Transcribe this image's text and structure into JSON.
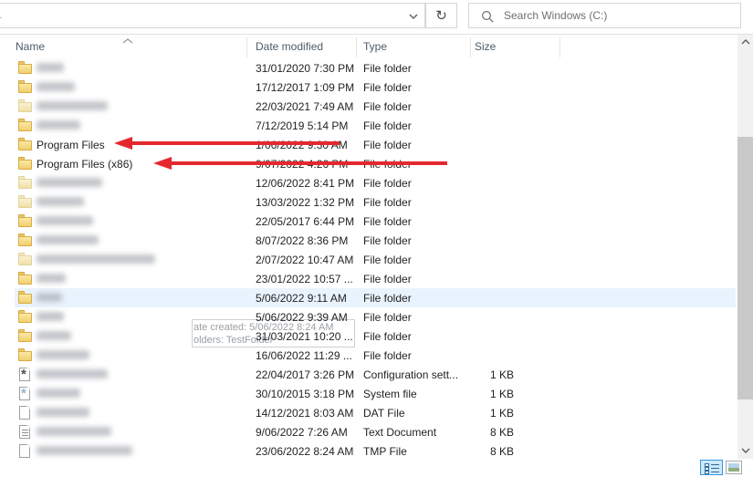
{
  "toolbar": {
    "refresh_glyph": "↻",
    "search": {
      "placeholder": "Search Windows (C:)"
    }
  },
  "columns": {
    "name": "Name",
    "date_modified": "Date modified",
    "type": "Type",
    "size": "Size"
  },
  "tooltip": {
    "line1": "ate created: 5/06/2022 8:24 AM",
    "line2": "olders: TestFolder"
  },
  "colors": {
    "arrow_red": "#e5282e",
    "row_highlight": "#e9f3fd",
    "folder_yellow": "#f2cf6e",
    "active_view_border": "#3a96dd"
  },
  "icons": {
    "search": "search-icon",
    "refresh": "refresh-icon",
    "address_chevron": "chevron-down-icon",
    "sort_ascending": "chevron-up-icon",
    "scroll_up": "chevron-up-icon",
    "scroll_down": "chevron-down-icon",
    "details_view": "details-view-icon",
    "thumbnails_view": "thumbnails-view-icon"
  },
  "rows": [
    {
      "name": "",
      "blurred": true,
      "blur_width": 30,
      "icon": "folder",
      "date": "31/01/2020 7:30 PM",
      "type": "File folder",
      "size": "",
      "highlighted": false
    },
    {
      "name": "",
      "blurred": true,
      "blur_width": 42,
      "icon": "folder",
      "date": "17/12/2017 1:09 PM",
      "type": "File folder",
      "size": "",
      "highlighted": false
    },
    {
      "name": "",
      "blurred": true,
      "blur_width": 78,
      "icon": "folder-pale",
      "date": "22/03/2021 7:49 AM",
      "type": "File folder",
      "size": "",
      "highlighted": false
    },
    {
      "name": "",
      "blurred": true,
      "blur_width": 48,
      "icon": "folder",
      "date": "7/12/2019 5:14 PM",
      "type": "File folder",
      "size": "",
      "highlighted": false
    },
    {
      "name": "Program Files",
      "blurred": false,
      "blur_width": 0,
      "icon": "folder",
      "date": "1/06/2022 9:30 AM",
      "type": "File folder",
      "size": "",
      "highlighted": false
    },
    {
      "name": "Program Files (x86)",
      "blurred": false,
      "blur_width": 0,
      "icon": "folder",
      "date": "9/07/2022 4:26 PM",
      "type": "File folder",
      "size": "",
      "highlighted": false
    },
    {
      "name": "",
      "blurred": true,
      "blur_width": 72,
      "icon": "folder-pale",
      "date": "12/06/2022 8:41 PM",
      "type": "File folder",
      "size": "",
      "highlighted": false
    },
    {
      "name": "",
      "blurred": true,
      "blur_width": 52,
      "icon": "folder-pale",
      "date": "13/03/2022 1:32 PM",
      "type": "File folder",
      "size": "",
      "highlighted": false
    },
    {
      "name": "",
      "blurred": true,
      "blur_width": 62,
      "icon": "folder",
      "date": "22/05/2017 6:44 PM",
      "type": "File folder",
      "size": "",
      "highlighted": false
    },
    {
      "name": "",
      "blurred": true,
      "blur_width": 68,
      "icon": "folder",
      "date": "8/07/2022 8:36 PM",
      "type": "File folder",
      "size": "",
      "highlighted": false
    },
    {
      "name": "",
      "blurred": true,
      "blur_width": 130,
      "icon": "folder-pale",
      "date": "2/07/2022 10:47 AM",
      "type": "File folder",
      "size": "",
      "highlighted": false
    },
    {
      "name": "",
      "blurred": true,
      "blur_width": 32,
      "icon": "folder",
      "date": "23/01/2022 10:57 ...",
      "type": "File folder",
      "size": "",
      "highlighted": false
    },
    {
      "name": "",
      "blurred": true,
      "blur_width": 28,
      "icon": "folder",
      "date": "5/06/2022 9:11 AM",
      "type": "File folder",
      "size": "",
      "highlighted": true
    },
    {
      "name": "",
      "blurred": true,
      "blur_width": 30,
      "icon": "folder",
      "date": "5/06/2022 9:39 AM",
      "type": "File folder",
      "size": "",
      "highlighted": false
    },
    {
      "name": "",
      "blurred": true,
      "blur_width": 38,
      "icon": "folder",
      "date": "31/03/2021 10:20 ...",
      "type": "File folder",
      "size": "",
      "highlighted": false
    },
    {
      "name": "",
      "blurred": true,
      "blur_width": 58,
      "icon": "folder",
      "date": "16/06/2022 11:29 ...",
      "type": "File folder",
      "size": "",
      "highlighted": false
    },
    {
      "name": "",
      "blurred": true,
      "blur_width": 78,
      "icon": "file-config",
      "date": "22/04/2017 3:26 PM",
      "type": "Configuration sett...",
      "size": "1 KB",
      "highlighted": false
    },
    {
      "name": "",
      "blurred": true,
      "blur_width": 48,
      "icon": "file-system",
      "date": "30/10/2015 3:18 PM",
      "type": "System file",
      "size": "1 KB",
      "highlighted": false
    },
    {
      "name": "",
      "blurred": true,
      "blur_width": 58,
      "icon": "file-plain",
      "date": "14/12/2021 8:03 AM",
      "type": "DAT File",
      "size": "1 KB",
      "highlighted": false
    },
    {
      "name": "",
      "blurred": true,
      "blur_width": 82,
      "icon": "file-text",
      "date": "9/06/2022 7:26 AM",
      "type": "Text Document",
      "size": "8 KB",
      "highlighted": false
    },
    {
      "name": "",
      "blurred": true,
      "blur_width": 105,
      "icon": "file-plain",
      "date": "23/06/2022 8:24 AM",
      "type": "TMP File",
      "size": "8 KB",
      "highlighted": false
    }
  ],
  "annotations": {
    "arrow1_target": "Program Files",
    "arrow2_target": "Program Files (x86)"
  }
}
